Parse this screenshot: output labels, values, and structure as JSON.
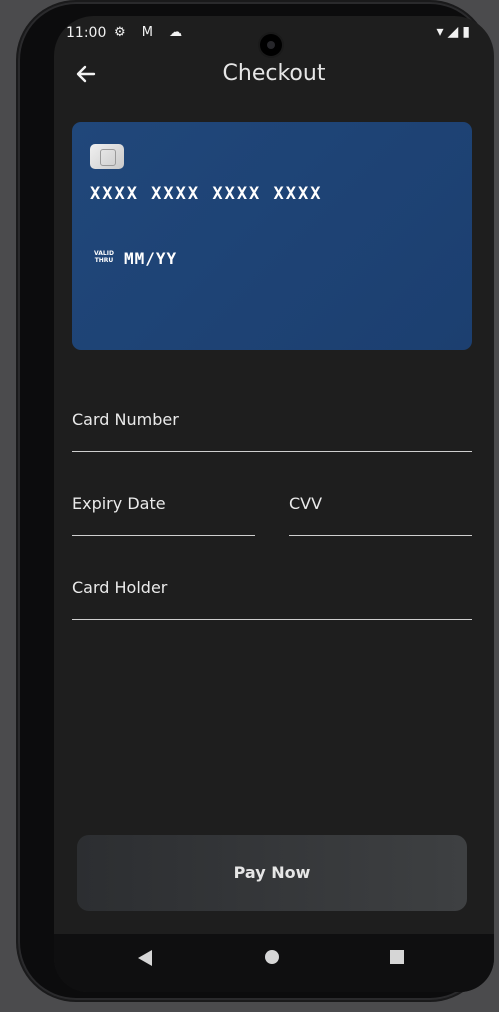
{
  "status": {
    "time": "11:00",
    "left_icons": "⚙ M ☁",
    "right_icons": "▾◢▮"
  },
  "appbar": {
    "title": "Checkout",
    "back_icon": "arrow-left-icon"
  },
  "card": {
    "number_mask": "XXXX XXXX XXXX XXXX",
    "valid_thru_label": "VALID THRU",
    "expiry_mask": "MM/YY",
    "color": "#1f467a"
  },
  "fields": {
    "card_number": {
      "label": "Card Number"
    },
    "expiry_date": {
      "label": "Expiry Date"
    },
    "cvv": {
      "label": "CVV"
    },
    "card_holder": {
      "label": "Card Holder"
    }
  },
  "actions": {
    "pay_label": "Pay Now"
  },
  "nav": {
    "back_icon": "back-triangle-icon",
    "home_icon": "home-circle-icon",
    "recents_icon": "recents-square-icon"
  }
}
